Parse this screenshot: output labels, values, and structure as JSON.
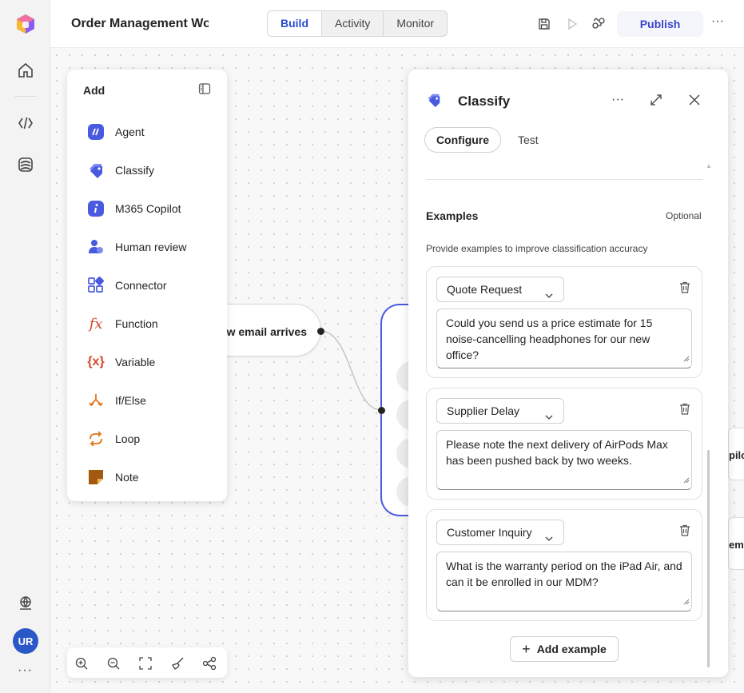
{
  "app": {
    "title": "Order Management Wo",
    "tabs": [
      "Build",
      "Activity",
      "Monitor"
    ],
    "publish_label": "Publish",
    "user_initials": "UR"
  },
  "add_panel": {
    "header": "Add",
    "items": [
      {
        "label": "Agent",
        "icon": "agent-icon"
      },
      {
        "label": "Classify",
        "icon": "tag-icon"
      },
      {
        "label": "M365 Copilot",
        "icon": "info-icon"
      },
      {
        "label": "Human review",
        "icon": "people-icon"
      },
      {
        "label": "Connector",
        "icon": "apps-icon"
      },
      {
        "label": "Function",
        "icon": "function-icon"
      },
      {
        "label": "Variable",
        "icon": "variable-icon"
      },
      {
        "label": "If/Else",
        "icon": "branch-icon"
      },
      {
        "label": "Loop",
        "icon": "loop-icon"
      },
      {
        "label": "Note",
        "icon": "note-icon"
      }
    ]
  },
  "canvas": {
    "trigger_label": "ew email arrives",
    "side_labels": [
      "pilo",
      "ema"
    ]
  },
  "classify_panel": {
    "title": "Classify",
    "tabs": {
      "configure": "Configure",
      "test": "Test"
    },
    "examples_heading": "Examples",
    "optional_label": "Optional",
    "description": "Provide examples to improve classification accuracy",
    "examples": [
      {
        "category": "Quote Request",
        "text": "Could you send us a price estimate for 15 noise-cancelling headphones for our new office?"
      },
      {
        "category": "Supplier Delay",
        "text": "Please note the next delivery of AirPods Max has been pushed back by two weeks."
      },
      {
        "category": "Customer Inquiry",
        "text": "What is the warranty period on the iPad Air, and can it be enrolled in our MDM?"
      }
    ],
    "add_example_label": "Add example"
  },
  "colors": {
    "accent": "#4a5ae0",
    "publish": "#3a46c9",
    "avatar": "#2b58c9"
  }
}
